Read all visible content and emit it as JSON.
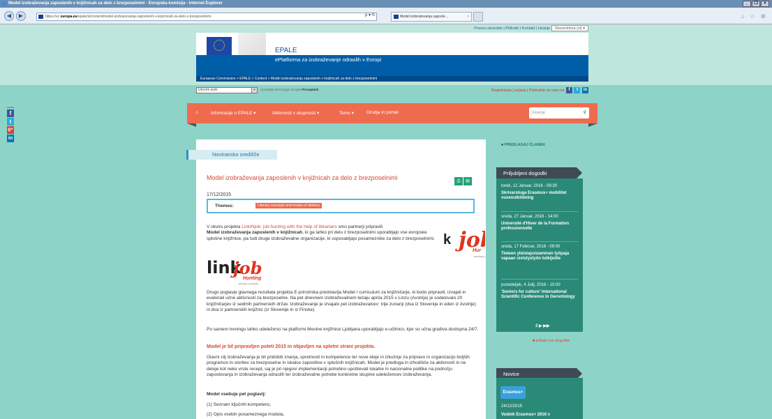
{
  "browser": {
    "title": "Model izobraževanja zaposlenih v knjižnicah za delo z brezposelnimi - Evropska komisija - Internet Explorer",
    "url_prefix": "https://ec.",
    "url_domain": "europa.eu",
    "url_rest": "/epale/sl/content/model-izobrazevanja-zaposlenih-v-knjiznicah-za-delo-z-brezposelnimi",
    "addr_controls": "ρ ▾ ↻",
    "tab_label": "Model izobraževanja zaposle...",
    "tab_close": "×",
    "back": "◀",
    "forward": "▶",
    "tools": "⌂ ☆ ⚙",
    "win_min": "_",
    "win_max": "❐",
    "win_close": "×"
  },
  "topbar": {
    "links": "Pravno obvestilo | Piškotki | Kontakt | Iskanje",
    "language": "Slovenščina (sl) ▾"
  },
  "header": {
    "eu_label": "European Commission",
    "title": "EPALE",
    "subtitle": "ePlatforma za izobraževanje odraslih v Evropi",
    "breadcrumb": "European Commission > EPALE > Content > Model izobraževanja zaposlenih v knjižnicah za delo z brezposelnimi"
  },
  "langbar": {
    "select_value": "Izberite jezik",
    "select_arrow": "▾",
    "powered": "Uporablja tehnologijo",
    "google": "Google",
    "translate": "Prevajalnik",
    "reg_links": "Registracija | prijava | Pridružite se nam na"
  },
  "social": {
    "fb": "f",
    "tw": "t",
    "li": "in",
    "gp": "g+"
  },
  "nav": {
    "home_icon": "⌂",
    "items": [
      "Informacije o EPALE ▾",
      "Aktivnosti v skupnosti ▾",
      "Teme ▾",
      "Orodja in portali"
    ],
    "search_placeholder": "Iskanje",
    "search_icon": "⚲"
  },
  "share": {
    "label": "SHARE"
  },
  "article": {
    "section": "Novinarsko središče",
    "title": "Model izobraževanja zaposlenih v knjižnicah za delo z brezposelnimi",
    "icon_print": "⎙",
    "icon_pdf": "▤",
    "date": "17/12/2015",
    "themes_label": "Themes:",
    "theme_tag": "Literacy concepts and modes of delivery",
    "p1_a": "V okviru projekta ",
    "p1_link": "LinkINjob: job-hunting with the help of librarians",
    "p1_b": " smo partnerji pripravili",
    "p1_bold": "Model izobraževanja zaposlenih v knjižnicah",
    "p1_c": ", ki ga lahko pri delu z brezposelnimi uporabljajo vse evropske splošne knjižnice, pa tudi druge izobraževalne organizacije, ki usposabljajo posameznike za delo z brezposelnimi.",
    "logo_link": "link",
    "logo_in": "IN",
    "logo_job": "job",
    "logo_hunting": "Hunting",
    "logo_tag": "with Help of Librarians",
    "logo_small_hunt": "Hur",
    "logo_small_tag": "with Help of",
    "p2": "Drugo poglavje glavnega rezultata projekta E-priročnika predstavlja Model / curriculum za knjižničarje, ki bodo pripravili, izvajali in evalvirali učne aktivnosti za brezposelne. Na pet dnevnem izobraževalnem tečaju aprila 2015 v Linzu (Avstrija) je sodelovalo 20 knjižničarjev iz sedmih partnerskih držav. Izobraževanje je izvajalo pet izobraževalcev: trije zunanji (dva iz Slovenije in eden iz Avstrije) in dva iz partnerskih knjižnic (iz Slovenije in iz Finske).",
    "p3": "Po samem treningu lahko udeleženci na platformi Mestne knjižnice Ljubljana uporabljajo e-učilnico, kjer so učna gradiva dostopna 24/7.",
    "p4": "Model je bil pripravljen poleti 2015 in objavljen na spletni strani projekta.",
    "p5": "Glavni cilj izobraževanja je bil pridobiti znanja, spretnosti in kompetence ter nove ideje in izkušnje za pripravo in organizacijo boljših programov in storitev za brezposelne in iskalce zaposlitve v splošnih knjižnicah. Model je predloga in izhodišče za aktivnosti in ne deluje kot neke vrste recept, saj je pri njegovi implementaciji potrebno upoštevati lokalne in nacionalne politike na področju zaposlovanja in izobraževanja odraslih ter izobraževalne potrebe konkretne skupine udeležencev izobraževanja.",
    "p6": "Model vsebuje pet poglavij:",
    "li1": "(1) Seznam ključnih kompetenc,",
    "li2": "(2) Opis vsebin posameznega modula,"
  },
  "sidebar": {
    "suggest": "■ PREDLAGAJ ČLANEK",
    "events_title": "Priljubljeni dogodki",
    "events": [
      {
        "date": "torek, 12 Januar, 2016 - 09:30",
        "title": "Skrivarstuga Erasmus+ mobilitet vuxenutbildning"
      },
      {
        "date": "sreda, 27 Januar, 2016 - 14:00",
        "title": "Université d'Hiver de la Formation professionnelle"
      },
      {
        "date": "sreda, 17 Februar, 2016 - 09:00",
        "title": "Tieteen yleistajuistaminen työpaja vapaan sivistystyön tutkijoille"
      },
      {
        "date": "ponedeljek, 4 Julij, 2016 - 15:00",
        "title": "'Seniors for culture' International Scientific Conference in Gerontology"
      }
    ],
    "pager": "2 ▶ ▶▶",
    "all_events": "■ prikaži vse dogodke",
    "news_title": "Novice",
    "news_logo": "Erasmus+",
    "news_date": "24/12/2015",
    "news_item": "Vodnik Erasmus+ 2016 v"
  }
}
